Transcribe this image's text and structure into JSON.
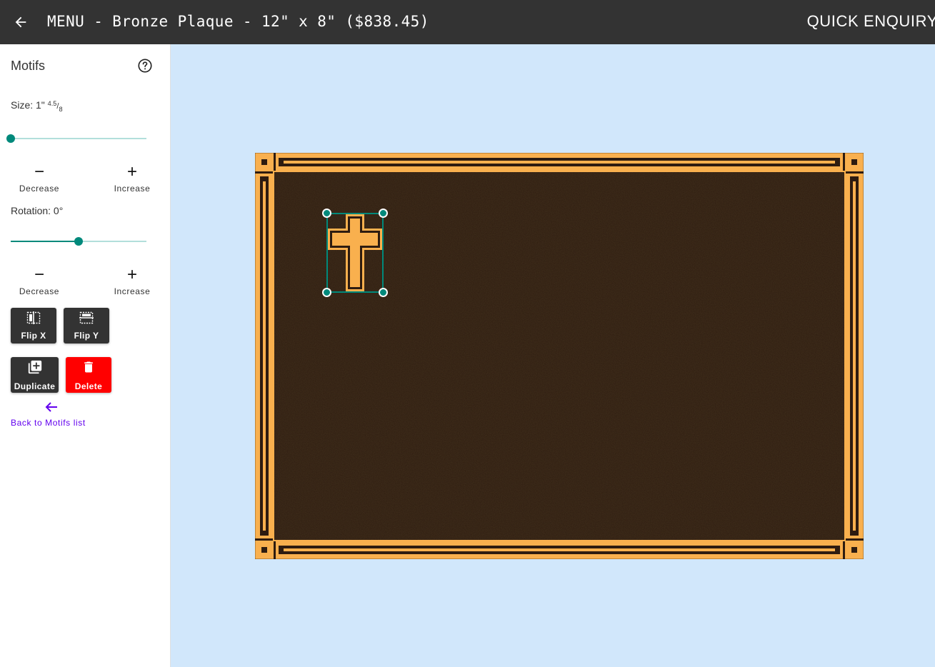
{
  "header": {
    "title": "MENU - Bronze Plaque - 12\" x 8\" ($838.45)",
    "quick_enquiry": "QUICK ENQUIRY"
  },
  "sidebar": {
    "title": "Motifs",
    "size": {
      "label": "Size: 1\"",
      "frac_num": "4.5",
      "frac_den": "8",
      "slider_fraction": 0.0
    },
    "size_decrease": {
      "symbol": "−",
      "label": "Decrease"
    },
    "size_increase": {
      "symbol": "+",
      "label": "Increase"
    },
    "rotation": {
      "label": "Rotation: 0°",
      "slider_fraction": 0.5
    },
    "rotation_decrease": {
      "symbol": "−",
      "label": "Decrease"
    },
    "rotation_increase": {
      "symbol": "+",
      "label": "Increase"
    },
    "flip_x": "Flip X",
    "flip_y": "Flip Y",
    "duplicate": "Duplicate",
    "delete": "Delete",
    "back": "Back to Motifs list"
  },
  "colors": {
    "topbar": "#333333",
    "canvas_bg": "#d1e7fb",
    "accent": "#00897b",
    "delete": "#ff0000",
    "link": "#6200ee",
    "bronze_gold": "#f9b04e",
    "plaque_dark": "#2e1c10"
  }
}
